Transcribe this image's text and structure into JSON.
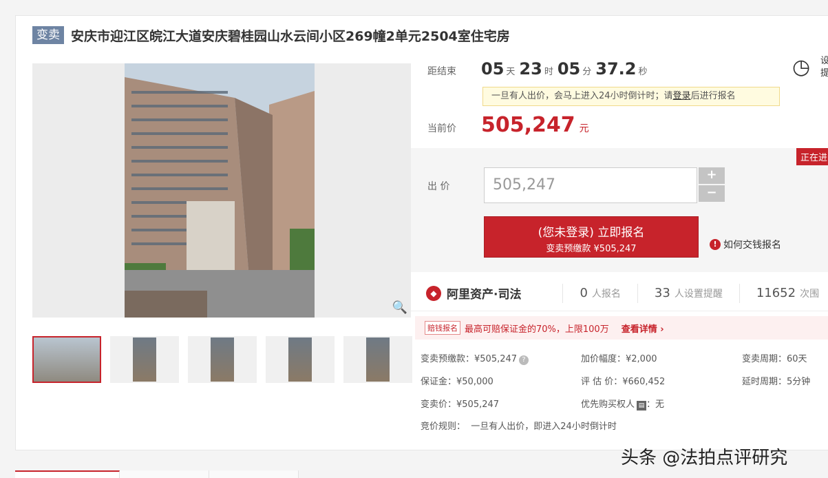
{
  "listing": {
    "tag": "变卖",
    "title": "安庆市迎江区皖江大道安庆碧桂园山水云间小区269幢2单元2504室住宅房"
  },
  "gallery": {
    "zoom_icon": "magnifier-icon",
    "thumbnail_count": 5
  },
  "countdown": {
    "label": "距结束",
    "days": "05",
    "days_unit": "天",
    "hours": "23",
    "hours_unit": "时",
    "minutes": "05",
    "minutes_unit": "分",
    "seconds": "37.2",
    "seconds_unit": "秒",
    "reminder_icon": "alarm-clock-icon",
    "reminder_text": "设提"
  },
  "notice": {
    "text_before": "一旦有人出价，会马上进入24小时倒计时；请",
    "login_link": "登录",
    "text_after": "后进行报名"
  },
  "current_price": {
    "label": "当前价",
    "value": "505,247",
    "unit": "元"
  },
  "bid": {
    "status_badge": "正在进",
    "label": "出 价",
    "input_value": "505,247",
    "plus": "+",
    "minus": "−",
    "signup_main": "(您未登录) 立即报名",
    "signup_sub": "变卖预缴款 ¥505,247",
    "how_to_pay": "如何交钱报名",
    "info_icon": "info-icon"
  },
  "stats": {
    "brand": "阿里资产·司法",
    "registrations_num": "0",
    "registrations_txt": "人报名",
    "reminders_num": "33",
    "reminders_txt": "人设置提醒",
    "views_num": "11652",
    "views_txt": "次围"
  },
  "promo": {
    "tag": "赔钱报名",
    "text": "最高可赔保证金的70%，上限100万",
    "link": "查看详情 ›"
  },
  "details": {
    "deposit_prepay": "变卖预缴款：¥505,247",
    "increment": "加价幅度：¥2,000",
    "sale_period": "变卖周期：60天",
    "guarantee": "保证金：¥50,000",
    "appraisal": "评 估 价：¥660,452",
    "delay_period": "延时周期：5分钟",
    "sale_price": "变卖价：¥505,247",
    "preemption": "优先购买权人",
    "preemption_value": "：无",
    "rules_label": "竞价规则：",
    "rules_value": "一旦有人出价，即进入24小时倒计时"
  },
  "watermark": "头条 @法拍点评研究"
}
